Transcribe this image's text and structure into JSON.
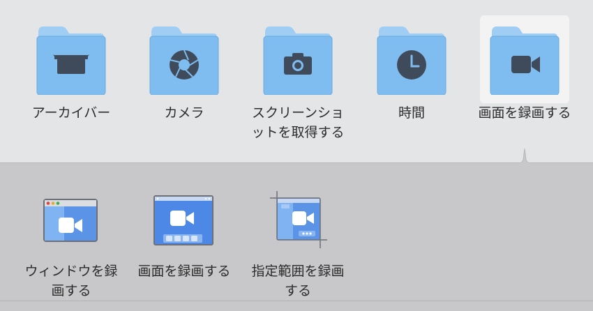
{
  "folders": [
    {
      "label": "アーカイバー",
      "icon": "archive-icon"
    },
    {
      "label": "カメラ",
      "icon": "aperture-icon"
    },
    {
      "label": "スクリーンショットを取得する",
      "label_line1": "スクリーンショ",
      "label_line2": "ットを取得する",
      "icon": "camera-icon"
    },
    {
      "label": "時間",
      "icon": "clock-icon"
    },
    {
      "label": "画面を録画する",
      "icon": "video-camera-icon",
      "selected": true
    }
  ],
  "options": [
    {
      "label_line1": "ウィンドウを録",
      "label_line2": "画する",
      "icon": "window-record-icon"
    },
    {
      "label_line1": "画面を録画する",
      "label_line2": "",
      "icon": "screen-record-icon"
    },
    {
      "label_line1": "指定範囲を録画",
      "label_line2": "する",
      "icon": "selection-record-icon"
    }
  ],
  "colors": {
    "folder_body": "#7fbdf0",
    "folder_tab": "#9fcdf4",
    "glyph": "#3f4b5b",
    "selection": "#f3f3f4"
  }
}
